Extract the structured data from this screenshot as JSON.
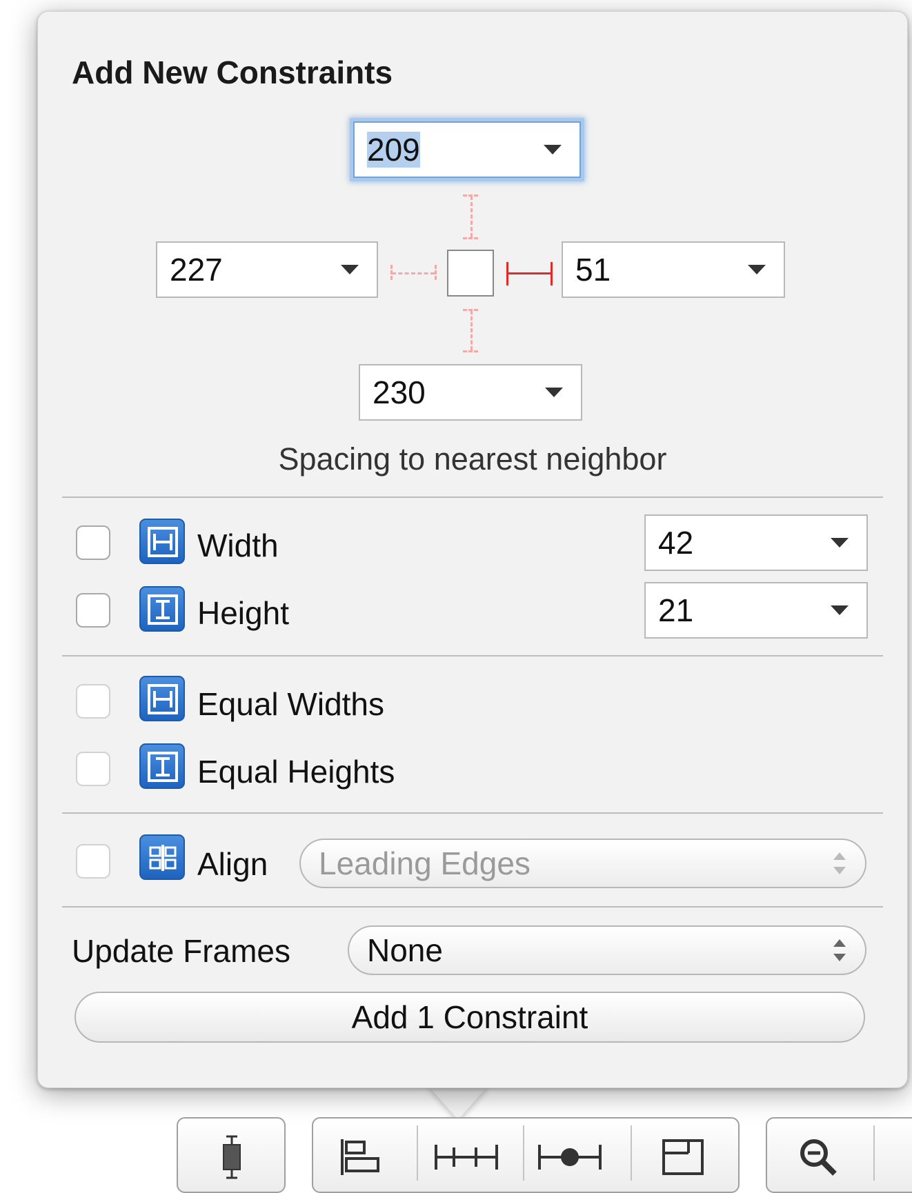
{
  "popover": {
    "title": "Add New Constraints",
    "spacing": {
      "top": "209",
      "left": "227",
      "right": "51",
      "bottom": "230",
      "caption": "Spacing to nearest neighbor"
    },
    "size_rows": [
      {
        "label": "Width",
        "value": "42",
        "icon": "width-icon"
      },
      {
        "label": "Height",
        "value": "21",
        "icon": "height-icon"
      }
    ],
    "equal_rows": [
      {
        "label": "Equal Widths",
        "icon": "equal-widths-icon"
      },
      {
        "label": "Equal Heights",
        "icon": "equal-heights-icon"
      }
    ],
    "align": {
      "label": "Align",
      "value": "Leading Edges",
      "icon": "align-icon"
    },
    "update_frames": {
      "label": "Update Frames",
      "value": "None"
    },
    "add_button": "Add 1 Constraint"
  },
  "toolbar": {
    "icons": [
      "resize-icon",
      "align-icon",
      "pin-icon",
      "resolve-icon",
      "frame-icon",
      "zoom-out-icon"
    ]
  },
  "colors": {
    "accent_blue": "#2f76d2",
    "constraint_red": "#e02a2a",
    "focus_ring": "#a9c9ec"
  }
}
